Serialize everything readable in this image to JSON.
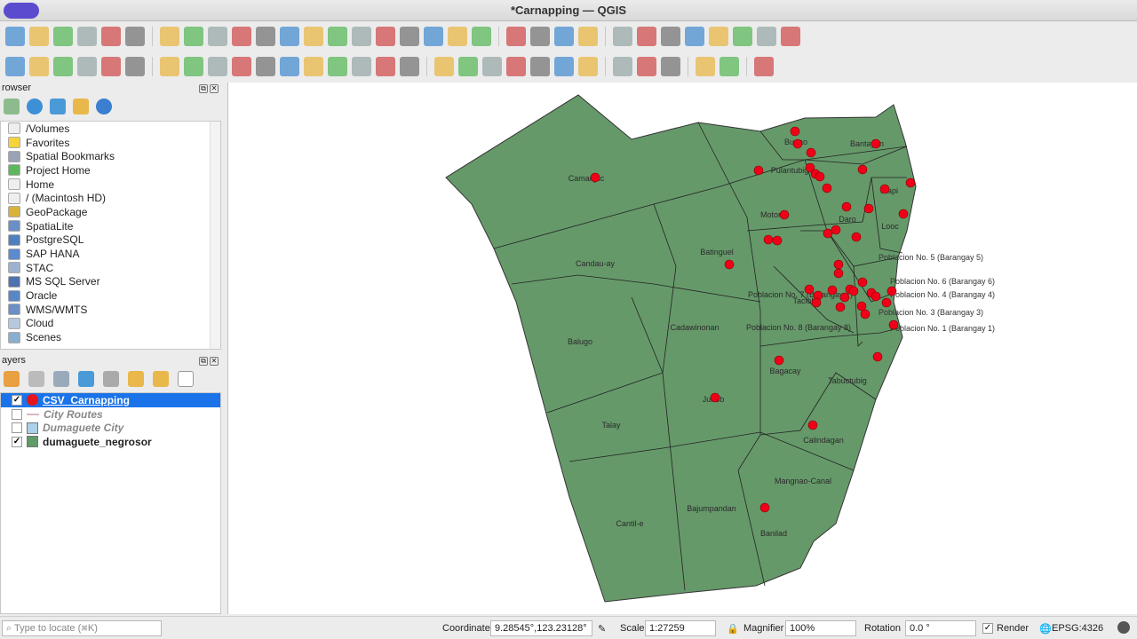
{
  "window": {
    "title": "*Carnapping — QGIS"
  },
  "browser": {
    "title": "rowser",
    "items": [
      {
        "label": "/Volumes",
        "icon": "folder-icon",
        "color": "#eeeeee"
      },
      {
        "label": "Favorites",
        "icon": "star-icon",
        "color": "#f5d33a"
      },
      {
        "label": "Spatial Bookmarks",
        "icon": "bookmark-icon",
        "color": "#9aa3b5"
      },
      {
        "label": "Project Home",
        "icon": "project-home-icon",
        "color": "#5cb85c"
      },
      {
        "label": "Home",
        "icon": "home-icon",
        "color": "#eeeeee"
      },
      {
        "label": "/ (Macintosh HD)",
        "icon": "folder-icon",
        "color": "#eeeeee"
      },
      {
        "label": "GeoPackage",
        "icon": "geopackage-icon",
        "color": "#d8b33a"
      },
      {
        "label": "SpatiaLite",
        "icon": "spatialite-icon",
        "color": "#6a8fc7"
      },
      {
        "label": "PostgreSQL",
        "icon": "postgresql-icon",
        "color": "#4f7fbf"
      },
      {
        "label": "SAP HANA",
        "icon": "sap-hana-icon",
        "color": "#5a8ad0"
      },
      {
        "label": "STAC",
        "icon": "stac-icon",
        "color": "#9db2d0"
      },
      {
        "label": "MS SQL Server",
        "icon": "mssql-icon",
        "color": "#4f73b0"
      },
      {
        "label": "Oracle",
        "icon": "oracle-icon",
        "color": "#5a86c6"
      },
      {
        "label": "WMS/WMTS",
        "icon": "wms-icon",
        "color": "#6a90c6"
      },
      {
        "label": "Cloud",
        "icon": "cloud-icon",
        "color": "#b6c8dd"
      },
      {
        "label": "Scenes",
        "icon": "scenes-icon",
        "color": "#8aaed0"
      }
    ]
  },
  "layers": {
    "title": "ayers",
    "items": [
      {
        "label": "CSV_Carnapping",
        "checked": true,
        "selected": true,
        "swatch": "#e8141b",
        "italic": false
      },
      {
        "label": "City Routes",
        "checked": false,
        "selected": false,
        "swatch": "#d9b7c0",
        "italic": true
      },
      {
        "label": "Dumaguete City",
        "checked": false,
        "selected": false,
        "swatch": "#a9d1e9",
        "italic": true
      },
      {
        "label": "dumaguete_negrosor",
        "checked": true,
        "selected": false,
        "swatch": "#5f9c67",
        "italic": false
      }
    ]
  },
  "map": {
    "fill": "#66996a",
    "point_color": "#f00018",
    "labels": [
      "Camanjac",
      "Bunao",
      "Bantayan",
      "Pulantubig",
      "Piapi",
      "Motong",
      "Daro",
      "Looc",
      "Batinguel",
      "Candau-ay",
      "Poblacion No. 5 (Barangay 5)",
      "Taclobo",
      "Poblacion No. 6 (Barangay 6)",
      "Poblacion No. 7 (Barangay 7)",
      "Poblacion No. 4 (Barangay 4)",
      "Poblacion No. 3 (Barangay 3)",
      "Cadawinonan",
      "Balugo",
      "Poblacion No. 8 (Barangay 8)",
      "Poblacion No. 1 (Barangay 1)",
      "Bagacay",
      "Tabuctubig",
      "Junob",
      "Talay",
      "Calindagan",
      "Mangnao-Canal",
      "Bajumpandan",
      "Cantil-e",
      "Banilad"
    ]
  },
  "status": {
    "locate_placeholder": "Type to locate (⌘K)",
    "coordinate_label": "Coordinate",
    "coordinate": "9.28545°,123.23128°",
    "scale_label": "Scale",
    "scale": "1:27259",
    "magnifier_label": "Magnifier",
    "magnifier": "100%",
    "rotation_label": "Rotation",
    "rotation": "0.0 °",
    "render_label": "Render",
    "render_checked": true,
    "crs": "EPSG:4326"
  }
}
